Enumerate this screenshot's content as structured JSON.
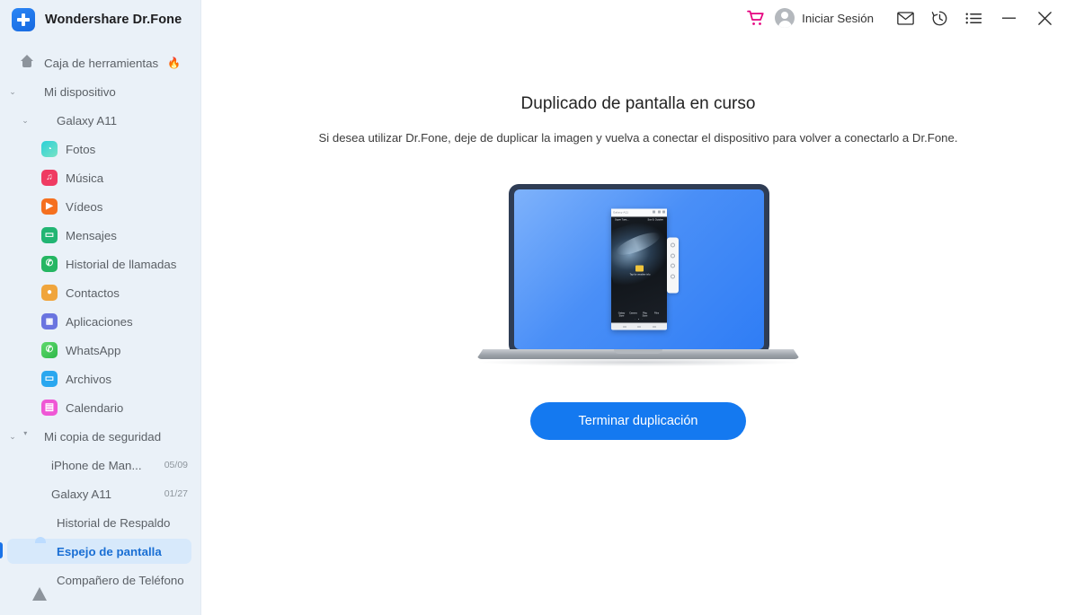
{
  "app": {
    "brand": "Wondershare Dr.Fone",
    "logo_icon": "plus-badge-icon",
    "accent": "#1a73e8"
  },
  "header": {
    "cart_icon": "shopping-cart-icon",
    "cart_color": "#e5007e",
    "signin_label": "Iniciar Sesión",
    "avatar_icon": "user-avatar-icon",
    "mail_icon": "envelope-icon",
    "history_icon": "clock-history-icon",
    "menu_icon": "list-menu-icon",
    "minimize_icon": "minimize-icon",
    "close_icon": "close-icon"
  },
  "sidebar": {
    "items": [
      {
        "label": "Caja de herramientas",
        "icon": "home-icon",
        "badge": "🔥",
        "level": 0,
        "caret": "",
        "selected": false
      },
      {
        "label": "Mi dispositivo",
        "icon": "phone-icon",
        "badge": "",
        "level": 0,
        "caret": "⌄",
        "selected": false
      },
      {
        "label": "Galaxy A11",
        "icon": "phone-icon",
        "badge": "",
        "level": 1,
        "caret": "⌄",
        "selected": false
      },
      {
        "label": "Fotos",
        "icon": "photos-icon",
        "color": "#2ec5d3",
        "level": 2,
        "selected": false
      },
      {
        "label": "Música",
        "icon": "music-icon",
        "color": "#ef3b62",
        "level": 2,
        "selected": false
      },
      {
        "label": "Vídeos",
        "icon": "videos-icon",
        "color": "#f5701f",
        "level": 2,
        "selected": false
      },
      {
        "label": "Mensajes",
        "icon": "messages-icon",
        "color": "#21b573",
        "level": 2,
        "selected": false
      },
      {
        "label": "Historial de llamadas",
        "icon": "call-history-icon",
        "color": "#25b662",
        "level": 2,
        "selected": false
      },
      {
        "label": "Contactos",
        "icon": "contacts-icon",
        "color": "#f0a53c",
        "level": 2,
        "selected": false
      },
      {
        "label": "Aplicaciones",
        "icon": "apps-icon",
        "color": "#6a74e0",
        "level": 2,
        "selected": false
      },
      {
        "label": "WhatsApp",
        "icon": "whatsapp-icon",
        "color": "#44c254",
        "level": 2,
        "selected": false
      },
      {
        "label": "Archivos",
        "icon": "files-icon",
        "color": "#2aa7ef",
        "level": 2,
        "selected": false
      },
      {
        "label": "Calendario",
        "icon": "calendar-icon",
        "color": "#ef57d5",
        "level": 2,
        "selected": false
      },
      {
        "label": "Mi copia de seguridad",
        "icon": "backup-drive-icon",
        "badge": "",
        "level": 0,
        "caret": "⌄",
        "selected": false
      },
      {
        "label": "iPhone de Man...",
        "icon": "phone-icon",
        "meta": "05/09",
        "level": 1,
        "selected": false
      },
      {
        "label": "Galaxy A11",
        "icon": "phone-icon",
        "meta": "01/27",
        "level": 1,
        "selected": false
      },
      {
        "label": "Historial de Respaldo",
        "icon": "restore-drive-icon",
        "level": 1,
        "selected": false
      },
      {
        "label": "Espejo de pantalla",
        "icon": "screen-mirror-icon",
        "level": 1,
        "selected": true
      },
      {
        "label": "Compañero de Teléfono",
        "icon": "phone-companion-icon",
        "level": 1,
        "selected": false
      }
    ]
  },
  "main": {
    "title": "Duplicado de pantalla en curso",
    "subtitle": "Si desea utilizar Dr.Fone, deje de duplicar la imagen y vuelva a conectar el dispositivo para volver a conectarlo a Dr.Fone.",
    "cta_label": "Terminar duplicación",
    "illustration": {
      "name": "laptop-mirroring-phone-illustration",
      "phone_window_title": "Galaxy A11",
      "phone_status_left": "Super Tues...",
      "phone_status_right": "Sun 8, October",
      "phone_folder_label": "Tap for weather info",
      "phone_apps_row1": [
        {
          "label": "Galaxy Store",
          "color": "#e0559c"
        },
        {
          "label": "Camera",
          "color": "#e8457e"
        },
        {
          "label": "Play Store",
          "color": "#f2f4f7"
        },
        {
          "label": "Files",
          "color": "#2f86e8"
        }
      ],
      "phone_apps_row2": [
        {
          "label": "Phone",
          "color": "#1fae55"
        },
        {
          "label": "Messages",
          "color": "#2d7ae0"
        },
        {
          "label": "Gallery",
          "color": "#e0424f"
        }
      ],
      "phone_panel_icons": [
        "record-icon",
        "screenshot-icon",
        "keyboard-icon",
        "settings-icon",
        "collapse-icon"
      ]
    }
  }
}
